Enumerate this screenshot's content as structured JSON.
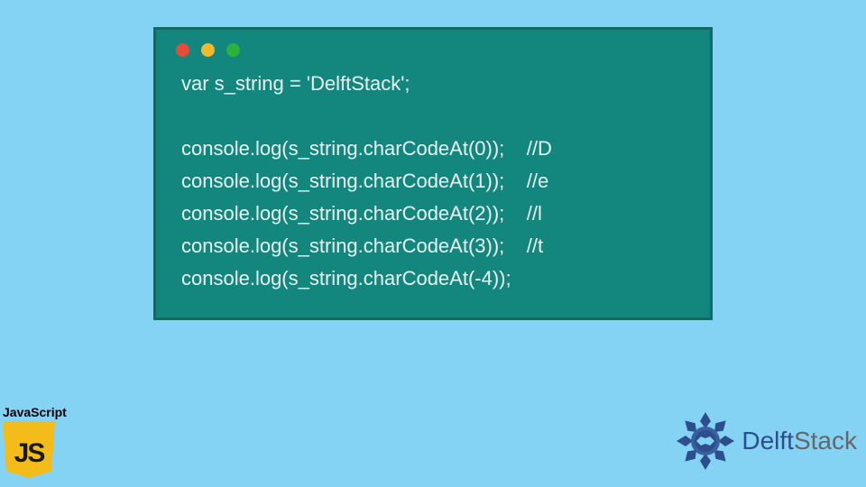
{
  "code": {
    "line1": "var s_string = 'DelftStack';",
    "line2": "console.log(s_string.charCodeAt(0));    //D",
    "line3": "console.log(s_string.charCodeAt(1));    //e",
    "line4": "console.log(s_string.charCodeAt(2));    //l",
    "line5": "console.log(s_string.charCodeAt(3));    //t",
    "line6": "console.log(s_string.charCodeAt(-4));"
  },
  "js_badge": {
    "label": "JavaScript",
    "letters": "JS"
  },
  "brand": {
    "part1": "Delft",
    "part2": "Stack"
  }
}
